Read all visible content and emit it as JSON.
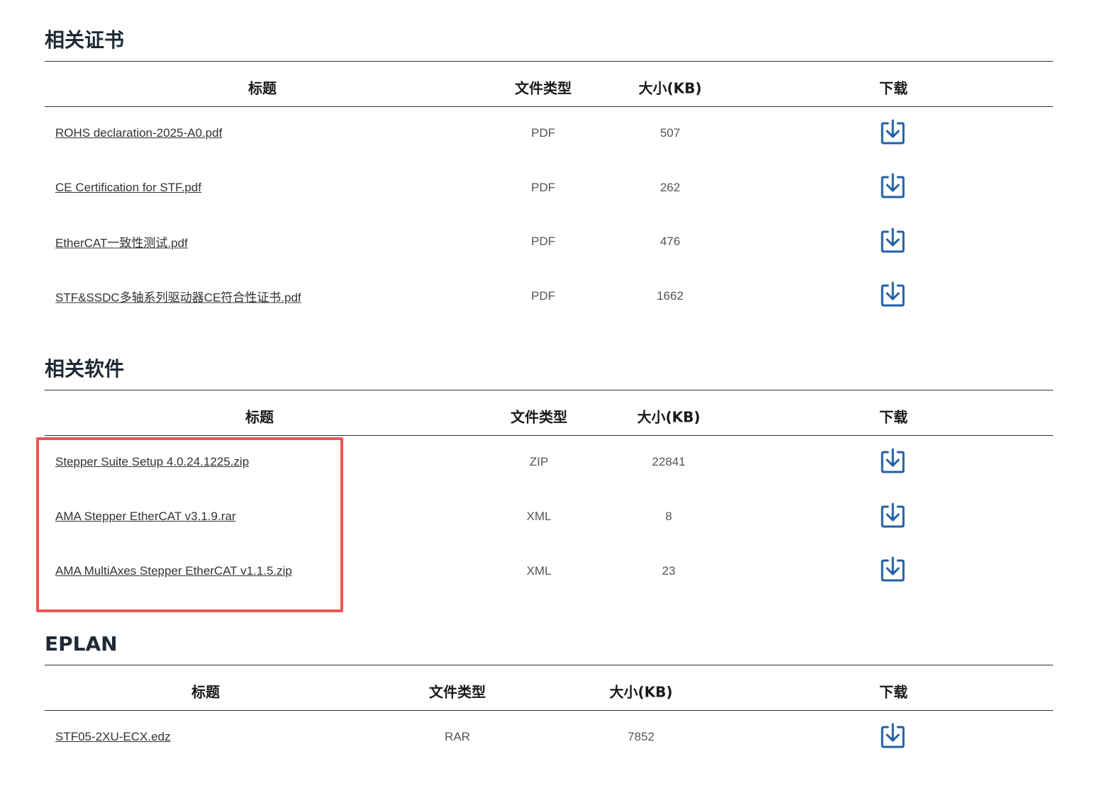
{
  "sections": [
    {
      "title": "相关证书",
      "headers": {
        "title": "标题",
        "type": "文件类型",
        "size": "大小(KB)",
        "download": "下载"
      },
      "rows": [
        {
          "name": "ROHS declaration-2025-A0.pdf",
          "type": "PDF",
          "size": "507"
        },
        {
          "name": "CE Certification for STF.pdf",
          "type": "PDF",
          "size": "262"
        },
        {
          "name": "EtherCAT一致性测试.pdf",
          "type": "PDF",
          "size": "476"
        },
        {
          "name": "STF&SSDC多轴系列驱动器CE符合性证书.pdf",
          "type": "PDF",
          "size": "1662"
        }
      ]
    },
    {
      "title": "相关软件",
      "headers": {
        "title": "标题",
        "type": "文件类型",
        "size": "大小(KB)",
        "download": "下载"
      },
      "rows": [
        {
          "name": "Stepper Suite Setup 4.0.24.1225.zip",
          "type": "ZIP",
          "size": "22841"
        },
        {
          "name": "AMA Stepper EtherCAT v3.1.9.rar",
          "type": "XML",
          "size": "8"
        },
        {
          "name": "AMA MultiAxes Stepper EtherCAT v1.1.5.zip",
          "type": "XML",
          "size": "23"
        }
      ]
    },
    {
      "title": "EPLAN",
      "headers": {
        "title": "标题",
        "type": "文件类型",
        "size": "大小(KB)",
        "download": "下载"
      },
      "rows": [
        {
          "name": "STF05-2XU-ECX.edz",
          "type": "RAR",
          "size": "7852"
        }
      ]
    }
  ],
  "icons": {
    "download": "download-icon"
  },
  "colors": {
    "download_icon": "#1f5fa8",
    "highlight": "#f05454"
  }
}
